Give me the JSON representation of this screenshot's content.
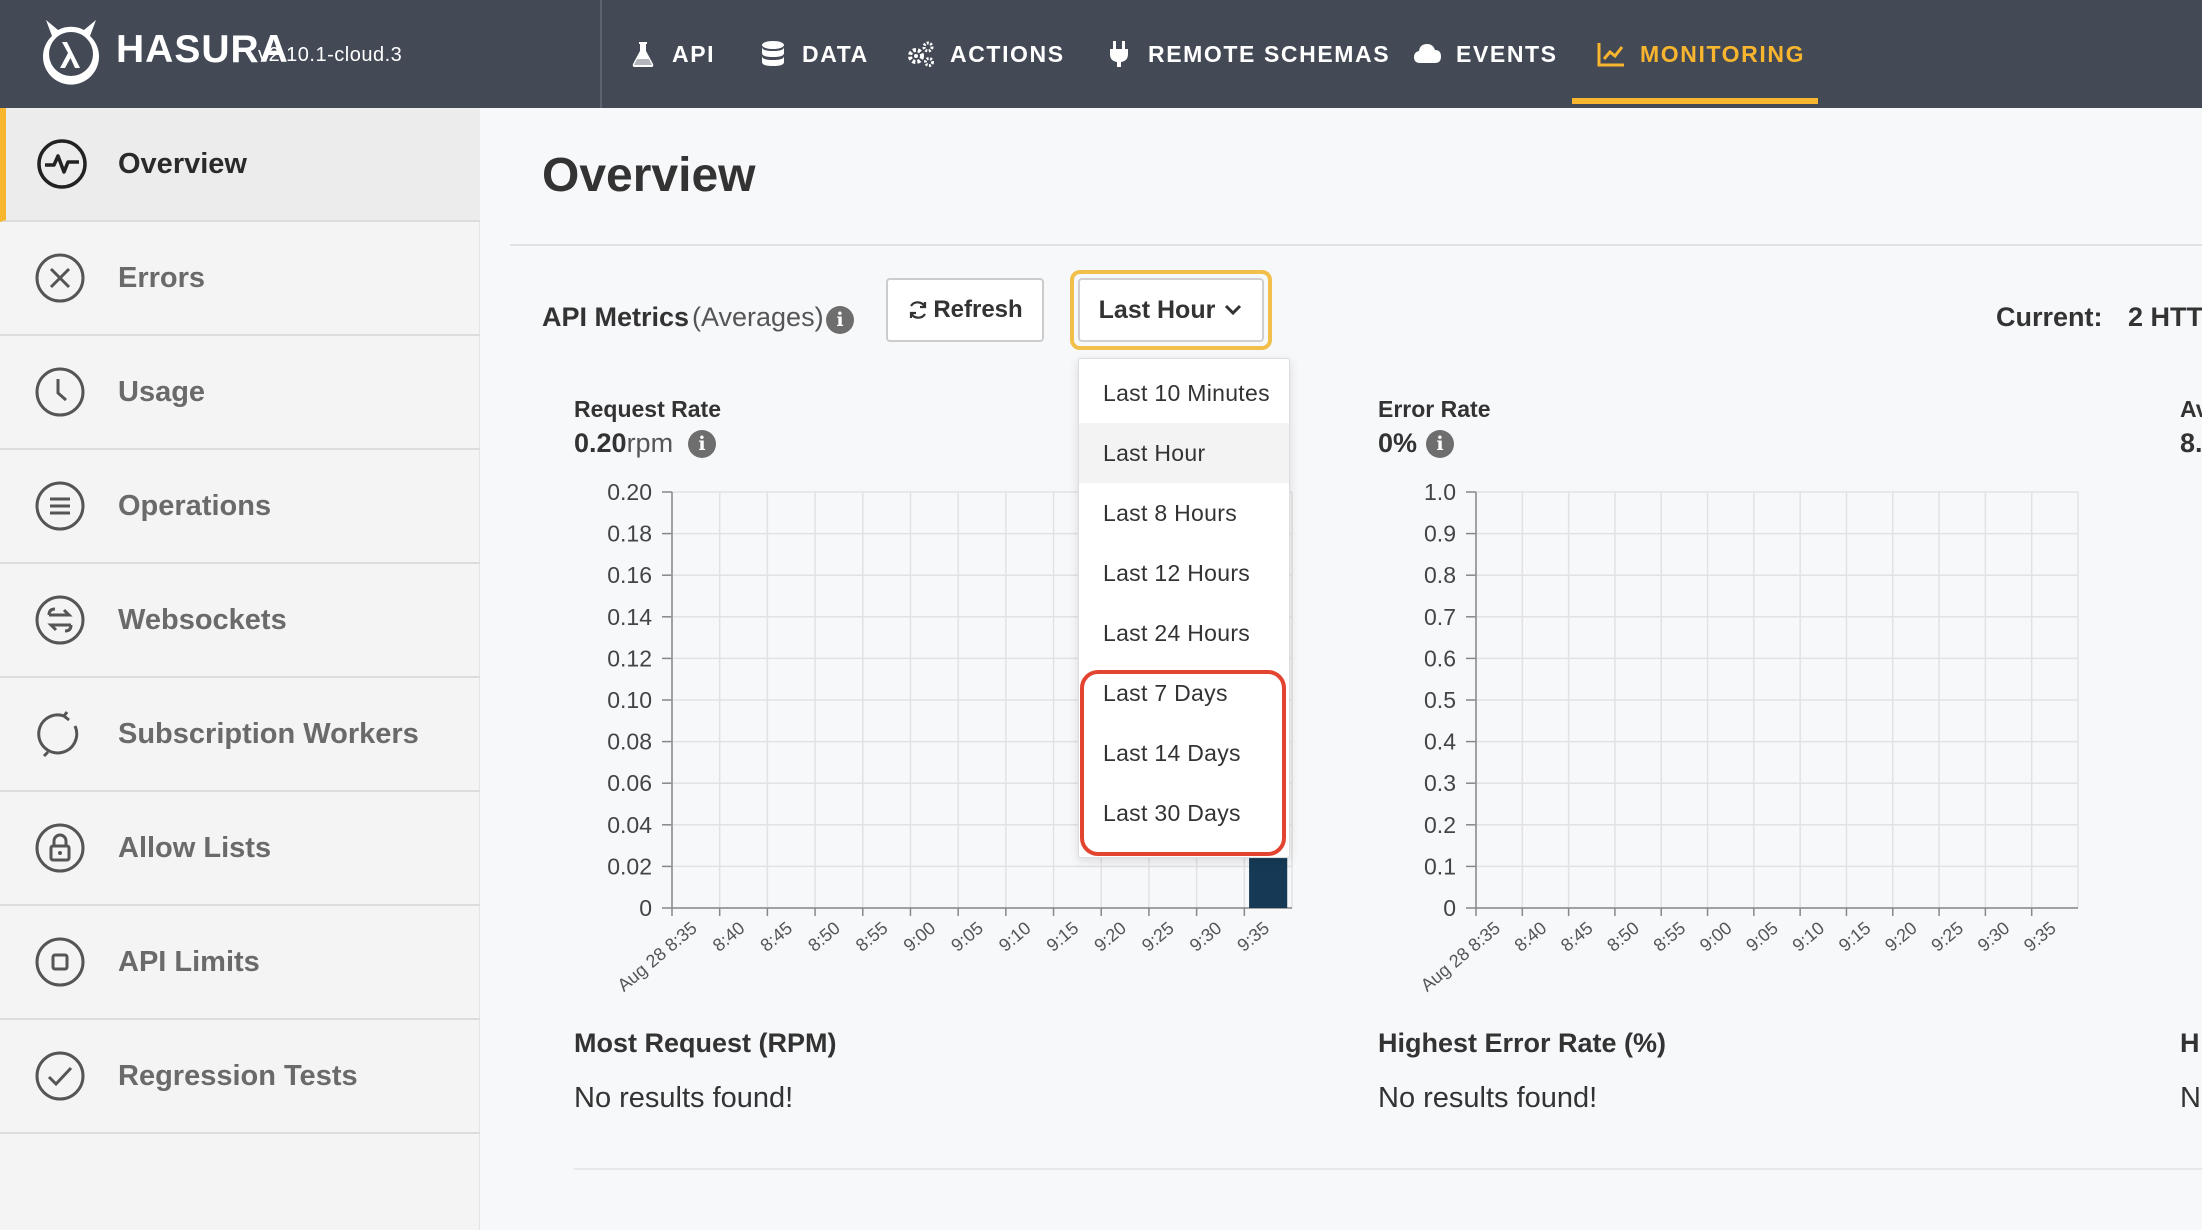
{
  "app": {
    "brand": "HASURA",
    "version": "v2.10.1-cloud.3",
    "nav": [
      {
        "label": "API",
        "icon": "flask-icon"
      },
      {
        "label": "DATA",
        "icon": "database-icon"
      },
      {
        "label": "ACTIONS",
        "icon": "gears-icon"
      },
      {
        "label": "REMOTE SCHEMAS",
        "icon": "plug-icon"
      },
      {
        "label": "EVENTS",
        "icon": "cloud-icon"
      },
      {
        "label": "MONITORING",
        "icon": "chart-line-icon",
        "active": true
      }
    ],
    "accent_color": "#f8b52e"
  },
  "sidebar": {
    "items": [
      {
        "label": "Overview",
        "icon": "pulse-icon",
        "active": true
      },
      {
        "label": "Errors",
        "icon": "error-x-icon"
      },
      {
        "label": "Usage",
        "icon": "clock-icon"
      },
      {
        "label": "Operations",
        "icon": "list-icon"
      },
      {
        "label": "Websockets",
        "icon": "exchange-icon"
      },
      {
        "label": "Subscription Workers",
        "icon": "refresh-icon"
      },
      {
        "label": "Allow Lists",
        "icon": "lock-icon"
      },
      {
        "label": "API Limits",
        "icon": "stop-icon"
      },
      {
        "label": "Regression Tests",
        "icon": "check-icon"
      }
    ]
  },
  "main": {
    "title": "Overview",
    "metrics_label": "API Metrics",
    "metrics_qualifier": "(Averages)",
    "refresh_label": "Refresh",
    "range_label": "Last Hour",
    "current_label": "Current:",
    "current_value": "2 HTT"
  },
  "dropdown": {
    "options": [
      "Last 10 Minutes",
      "Last Hour",
      "Last 8 Hours",
      "Last 12 Hours",
      "Last 24 Hours",
      "Last 7 Days",
      "Last 14 Days",
      "Last 30 Days"
    ],
    "selected": "Last Hour",
    "highlighted_options": [
      "Last 7 Days",
      "Last 14 Days",
      "Last 30 Days"
    ],
    "highlight_color": "#e2442f"
  },
  "metrics": {
    "request_rate": {
      "title": "Request Rate",
      "value": "0.20",
      "unit": "rpm"
    },
    "error_rate": {
      "title": "Error Rate",
      "value": "0%"
    },
    "third_title": "Av",
    "third_value": "8."
  },
  "sections": {
    "most_request": {
      "title": "Most Request (RPM)",
      "empty": "No results found!"
    },
    "highest_error": {
      "title": "Highest Error Rate (%)",
      "empty": "No results found!"
    },
    "third": {
      "title": "H",
      "empty": "N"
    }
  },
  "chart_data": [
    {
      "type": "bar",
      "title": "Request Rate",
      "categories": [
        "Aug 28 8:35",
        "8:40",
        "8:45",
        "8:50",
        "8:55",
        "9:00",
        "9:05",
        "9:10",
        "9:15",
        "9:20",
        "9:25",
        "9:30",
        "9:35"
      ],
      "yticks": [
        "0.20",
        "0.18",
        "0.16",
        "0.14",
        "0.12",
        "0.10",
        "0.08",
        "0.06",
        "0.04",
        "0.02",
        "0"
      ],
      "ylim": [
        0,
        0.2
      ],
      "bars": [
        {
          "category": "9:35",
          "value": 0.024
        }
      ],
      "bar_color": "#163a56",
      "grid": true
    },
    {
      "type": "bar",
      "title": "Error Rate",
      "categories": [
        "Aug 28 8:35",
        "8:40",
        "8:45",
        "8:50",
        "8:55",
        "9:00",
        "9:05",
        "9:10",
        "9:15",
        "9:20",
        "9:25",
        "9:30",
        "9:35"
      ],
      "yticks": [
        "1.0",
        "0.9",
        "0.8",
        "0.7",
        "0.6",
        "0.5",
        "0.4",
        "0.3",
        "0.2",
        "0.1",
        "0"
      ],
      "ylim": [
        0,
        1
      ],
      "bars": [],
      "grid": true
    }
  ]
}
